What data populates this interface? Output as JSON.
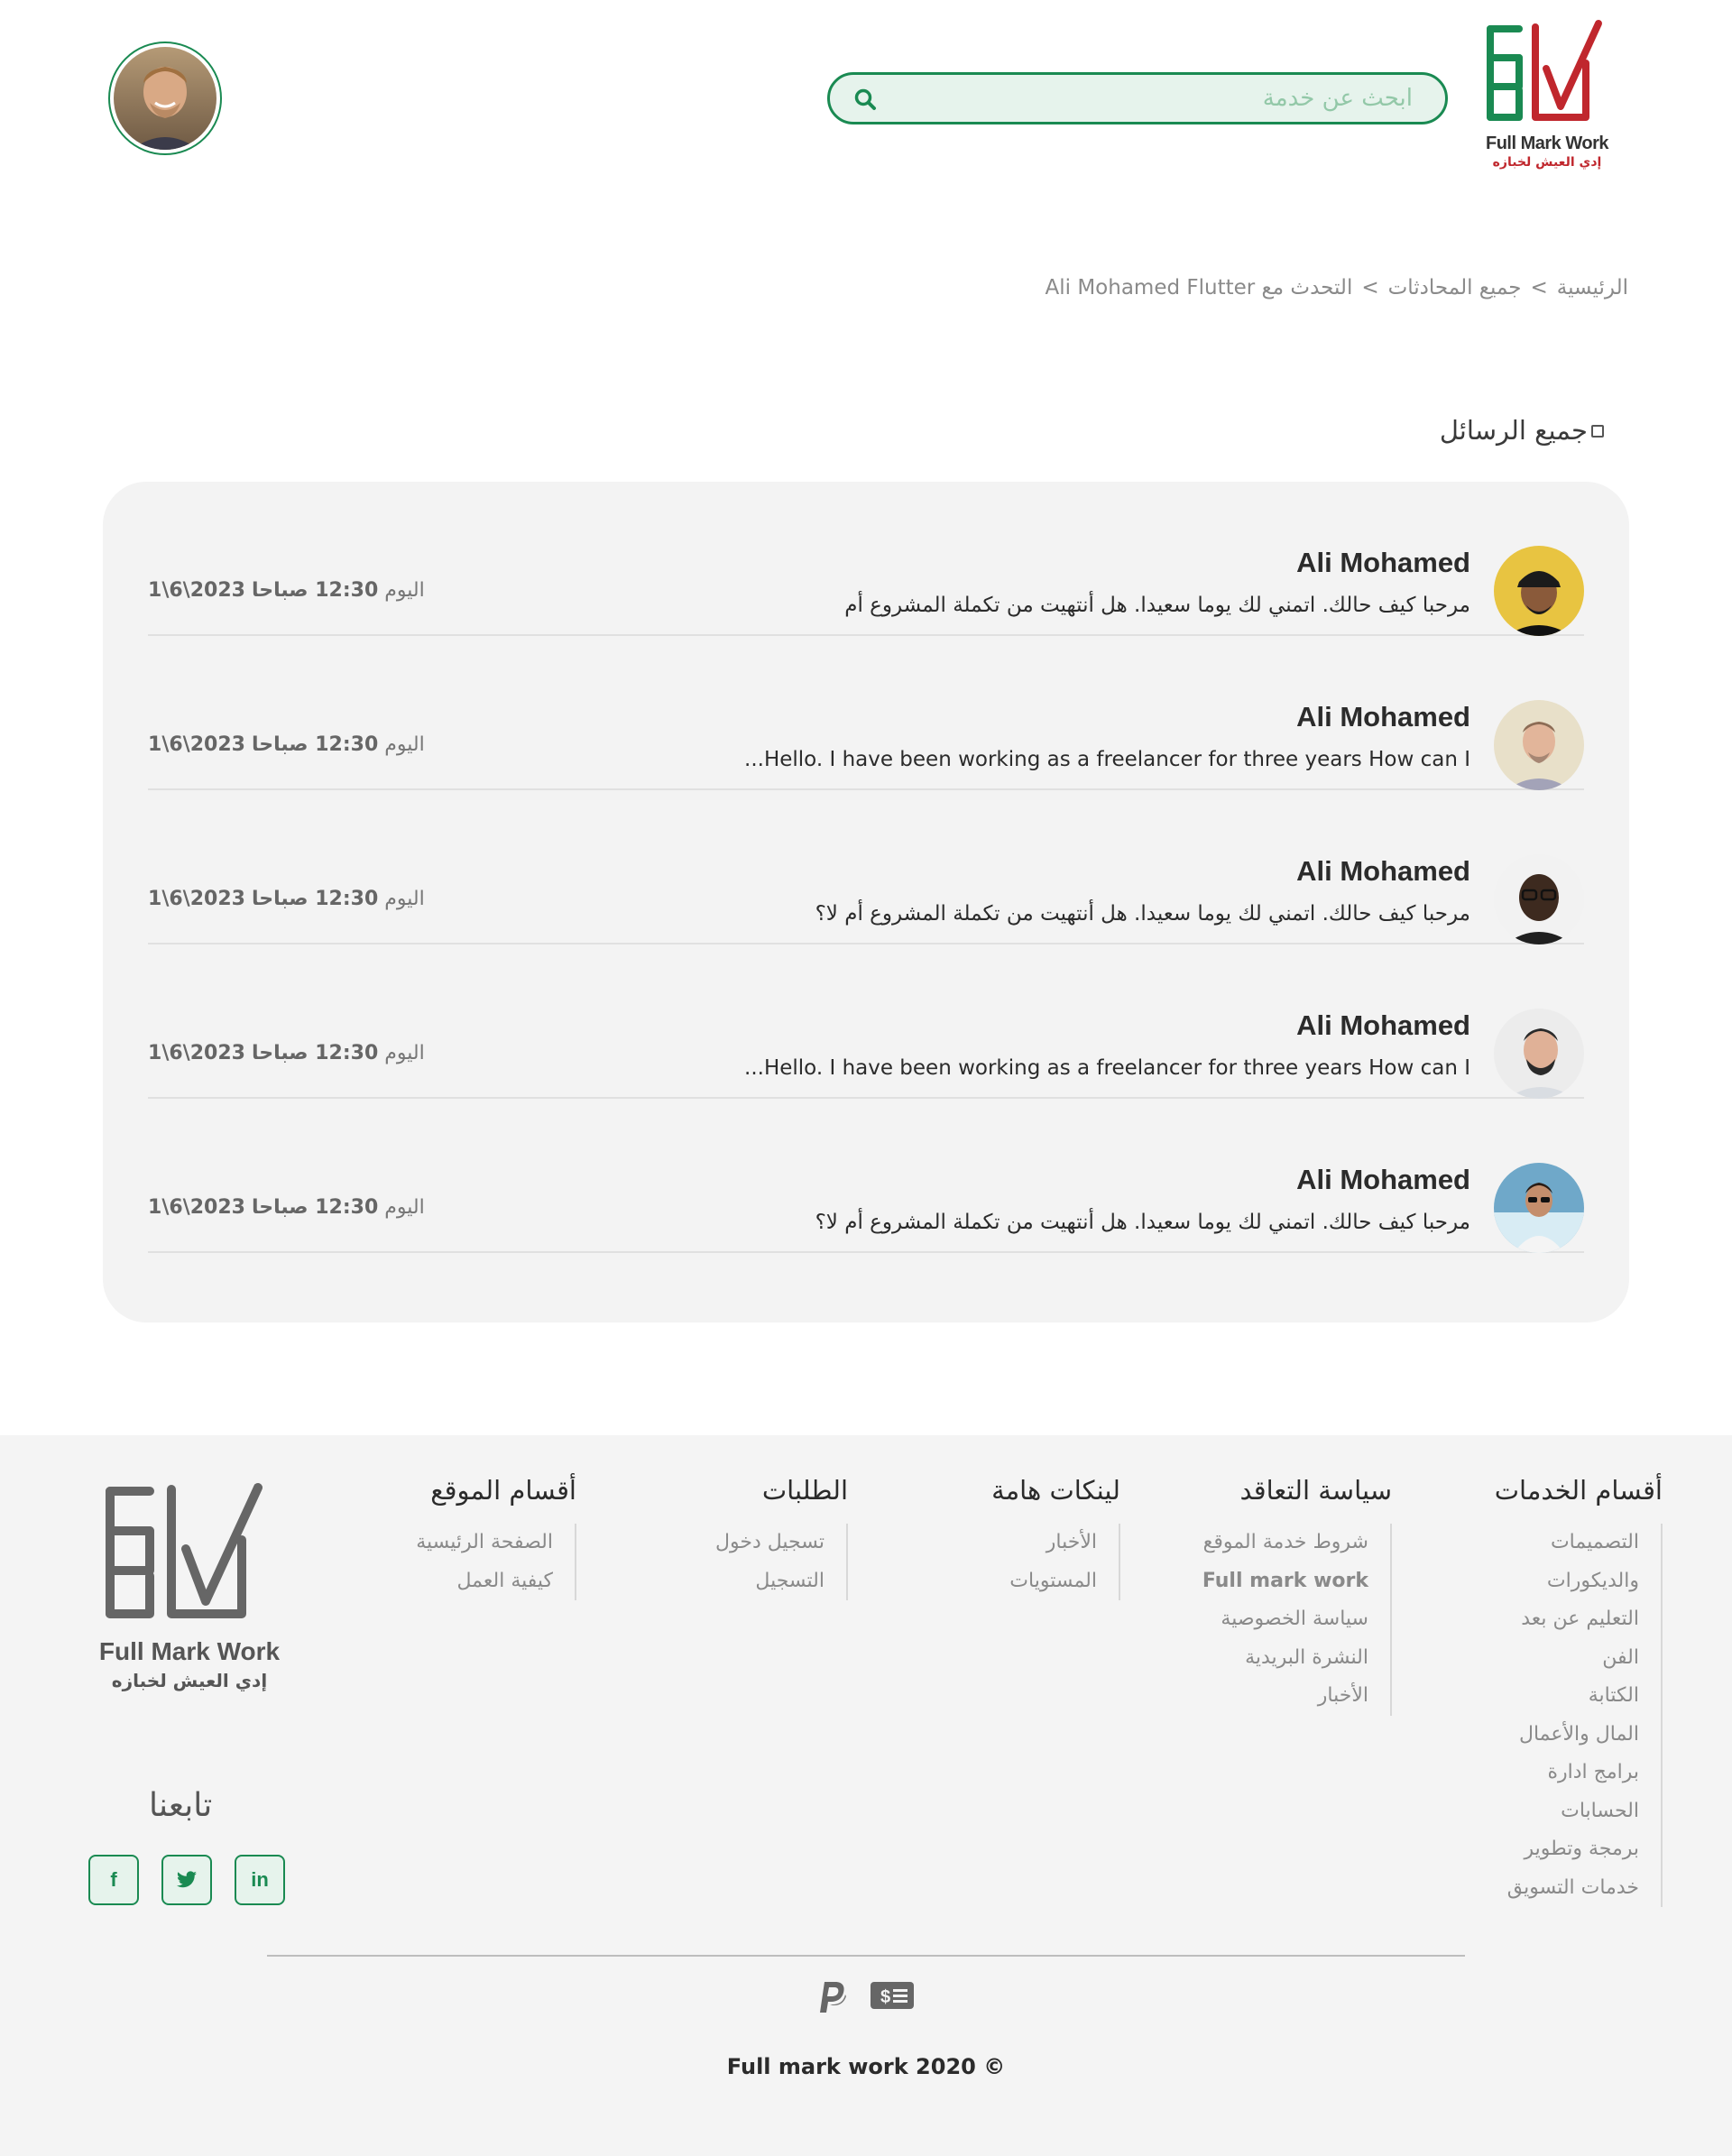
{
  "brand": {
    "logo_text_en": "Full Mark Work",
    "logo_text_ar": "إدي العيش لخبازه",
    "accent": "#1a8a52",
    "accent_red": "#c0272d"
  },
  "search": {
    "placeholder": "ابحث عن خدمة",
    "value": ""
  },
  "breadcrumb": [
    "الرئيسية",
    "جميع المحادثات",
    "التحدث مع Ali Mohamed Flutter"
  ],
  "breadcrumb_sep": ">",
  "section_title": "جميع الرسائل",
  "messages": [
    {
      "name": "Ali Mohamed",
      "preview": "مرحبا كيف حالك. اتمني لك يوما سعيدا. هل أنتهيت من تكملة المشروع أم",
      "time_prefix": "اليوم",
      "time": "12:30 صباحا",
      "date": "2023\\6\\1",
      "avatar_color": "#e8c441"
    },
    {
      "name": "Ali Mohamed",
      "preview": "Hello. I have been working as a freelancer for three years How can I...",
      "time_prefix": "اليوم",
      "time": "12:30 صباحا",
      "date": "2023\\6\\1",
      "avatar_color": "#e8e0c9"
    },
    {
      "name": "Ali Mohamed",
      "preview": "مرحبا كيف حالك. اتمني لك يوما سعيدا. هل أنتهيت من تكملة المشروع أم لا؟",
      "time_prefix": "اليوم",
      "time": "12:30 صباحا",
      "date": "2023\\6\\1",
      "avatar_color": "#f2f2f2"
    },
    {
      "name": "Ali Mohamed",
      "preview": "Hello. I have been working as a freelancer for three years How can I...",
      "time_prefix": "اليوم",
      "time": "12:30 صباحا",
      "date": "2023\\6\\1",
      "avatar_color": "#ececec"
    },
    {
      "name": "Ali Mohamed",
      "preview": "مرحبا كيف حالك. اتمني لك يوما سعيدا. هل أنتهيت من تكملة المشروع أم لا؟",
      "time_prefix": "اليوم",
      "time": "12:30 صباحا",
      "date": "2023\\6\\1",
      "avatar_color": "#6fa8c9"
    }
  ],
  "footer": {
    "columns": [
      {
        "title": "أقسام الخدمات",
        "items": [
          "التصميمات",
          "والديكورات",
          "التعليم عن بعد",
          "الفن",
          "الكتابة",
          "المال والأعمال",
          "برامج ادارة",
          "الحسابات",
          "برمجة وتطوير",
          "خدمات التسويق"
        ]
      },
      {
        "title": "سياسة التعاقد",
        "items": [
          "شروط خدمة الموقع",
          "Full mark work",
          "سياسة الخصوصية",
          "النشرة البريدية",
          "الأخبار"
        ]
      },
      {
        "title": "لينكات هامة",
        "items": [
          "الأخبار",
          "المستويات"
        ]
      },
      {
        "title": "الطلبات",
        "items": [
          "تسجيل دخول",
          "التسجيل"
        ]
      },
      {
        "title": "أقسام الموقع",
        "items": [
          "الصفحة الرئيسية",
          "كيفية العمل"
        ]
      }
    ],
    "follow_title": "تابعنا",
    "social": [
      {
        "name": "facebook",
        "label": "f"
      },
      {
        "name": "twitter",
        "label": "t"
      },
      {
        "name": "linkedin",
        "label": "in"
      }
    ],
    "payment_icons": [
      "paypal-icon",
      "cash-icon"
    ],
    "copyright": "Full mark work 2020 ©"
  }
}
